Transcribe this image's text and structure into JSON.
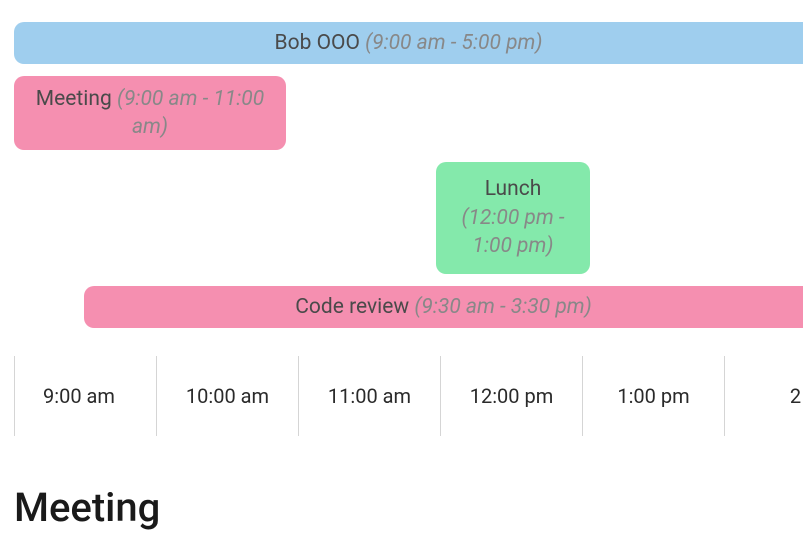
{
  "events": {
    "bob": {
      "title": "Bob OOO",
      "timespan": "(9:00 am - 5:00 pm)"
    },
    "meeting": {
      "title": "Meeting",
      "timespan": "(9:00 am - 11:00 am)"
    },
    "lunch": {
      "title": "Lunch",
      "timespan": "(12:00 pm - 1:00 pm)"
    },
    "codereview": {
      "title": "Code review",
      "timespan": "(9:30 am - 3:30 pm)"
    }
  },
  "axis": {
    "t0": "9:00 am",
    "t1": "10:00 am",
    "t2": "11:00 am",
    "t3": "12:00 pm",
    "t4": "1:00 pm",
    "t5": "2"
  },
  "detail": {
    "heading": "Meeting"
  }
}
